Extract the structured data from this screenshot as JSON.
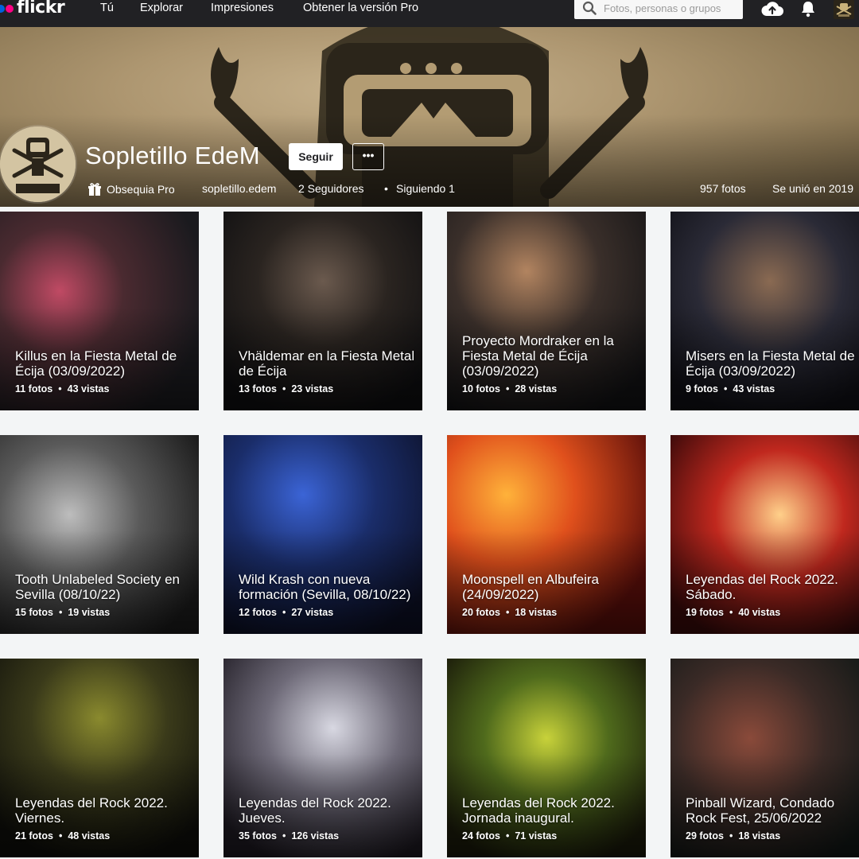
{
  "nav": {
    "logo": "flickr",
    "links": [
      "Tú",
      "Explorar",
      "Impresiones",
      "Obtener la versión Pro"
    ],
    "search_placeholder": "Fotos, personas o grupos",
    "icons": [
      "search-icon",
      "upload-cloud-icon",
      "notifications-bell-icon",
      "user-avatar"
    ]
  },
  "profile": {
    "name": "Sopletillo EdeM",
    "follow_label": "Seguir",
    "more_label": "•••",
    "gift_label": "Obsequia Pro",
    "username": "sopletillo.edem",
    "followers_label": "2 Seguidores",
    "following_label": "Siguiendo 1",
    "photos_label": "957 fotos",
    "joined_label": "Se unió en 2019"
  },
  "colors": {
    "nav_bg": "#212124",
    "page_bg": "#f3f5f6",
    "flickr_blue": "#0063dc",
    "flickr_pink": "#ff0084"
  },
  "albums": [
    {
      "title": "Killus en la Fiesta Metal de Écija (03/09/2022)",
      "photos": "11 fotos",
      "views": "43 vistas"
    },
    {
      "title": "Vhäldemar en la Fiesta Metal de Écija",
      "photos": "13 fotos",
      "views": "23 vistas"
    },
    {
      "title": "Proyecto Mordraker en la Fiesta Metal de Écija (03/09/2022)",
      "photos": "10 fotos",
      "views": "28 vistas"
    },
    {
      "title": "Misers en la Fiesta Metal de Écija (03/09/2022)",
      "photos": "9 fotos",
      "views": "43 vistas"
    },
    {
      "title": "Tooth Unlabeled Society en Sevilla (08/10/22)",
      "photos": "15 fotos",
      "views": "19 vistas"
    },
    {
      "title": "Wild Krash con nueva formación (Sevilla, 08/10/22)",
      "photos": "12 fotos",
      "views": "27 vistas"
    },
    {
      "title": "Moonspell en Albufeira (24/09/2022)",
      "photos": "20 fotos",
      "views": "18 vistas"
    },
    {
      "title": "Leyendas del Rock 2022. Sábado.",
      "photos": "19 fotos",
      "views": "40 vistas"
    },
    {
      "title": "Leyendas del Rock 2022. Viernes.",
      "photos": "21 fotos",
      "views": "48 vistas"
    },
    {
      "title": "Leyendas del Rock 2022. Jueves.",
      "photos": "35 fotos",
      "views": "126 vistas"
    },
    {
      "title": "Leyendas del Rock 2022. Jornada inaugural.",
      "photos": "24 fotos",
      "views": "71 vistas"
    },
    {
      "title": "Pinball Wizard, Condado Rock Fest, 25/06/2022",
      "photos": "29 fotos",
      "views": "18 vistas"
    }
  ]
}
